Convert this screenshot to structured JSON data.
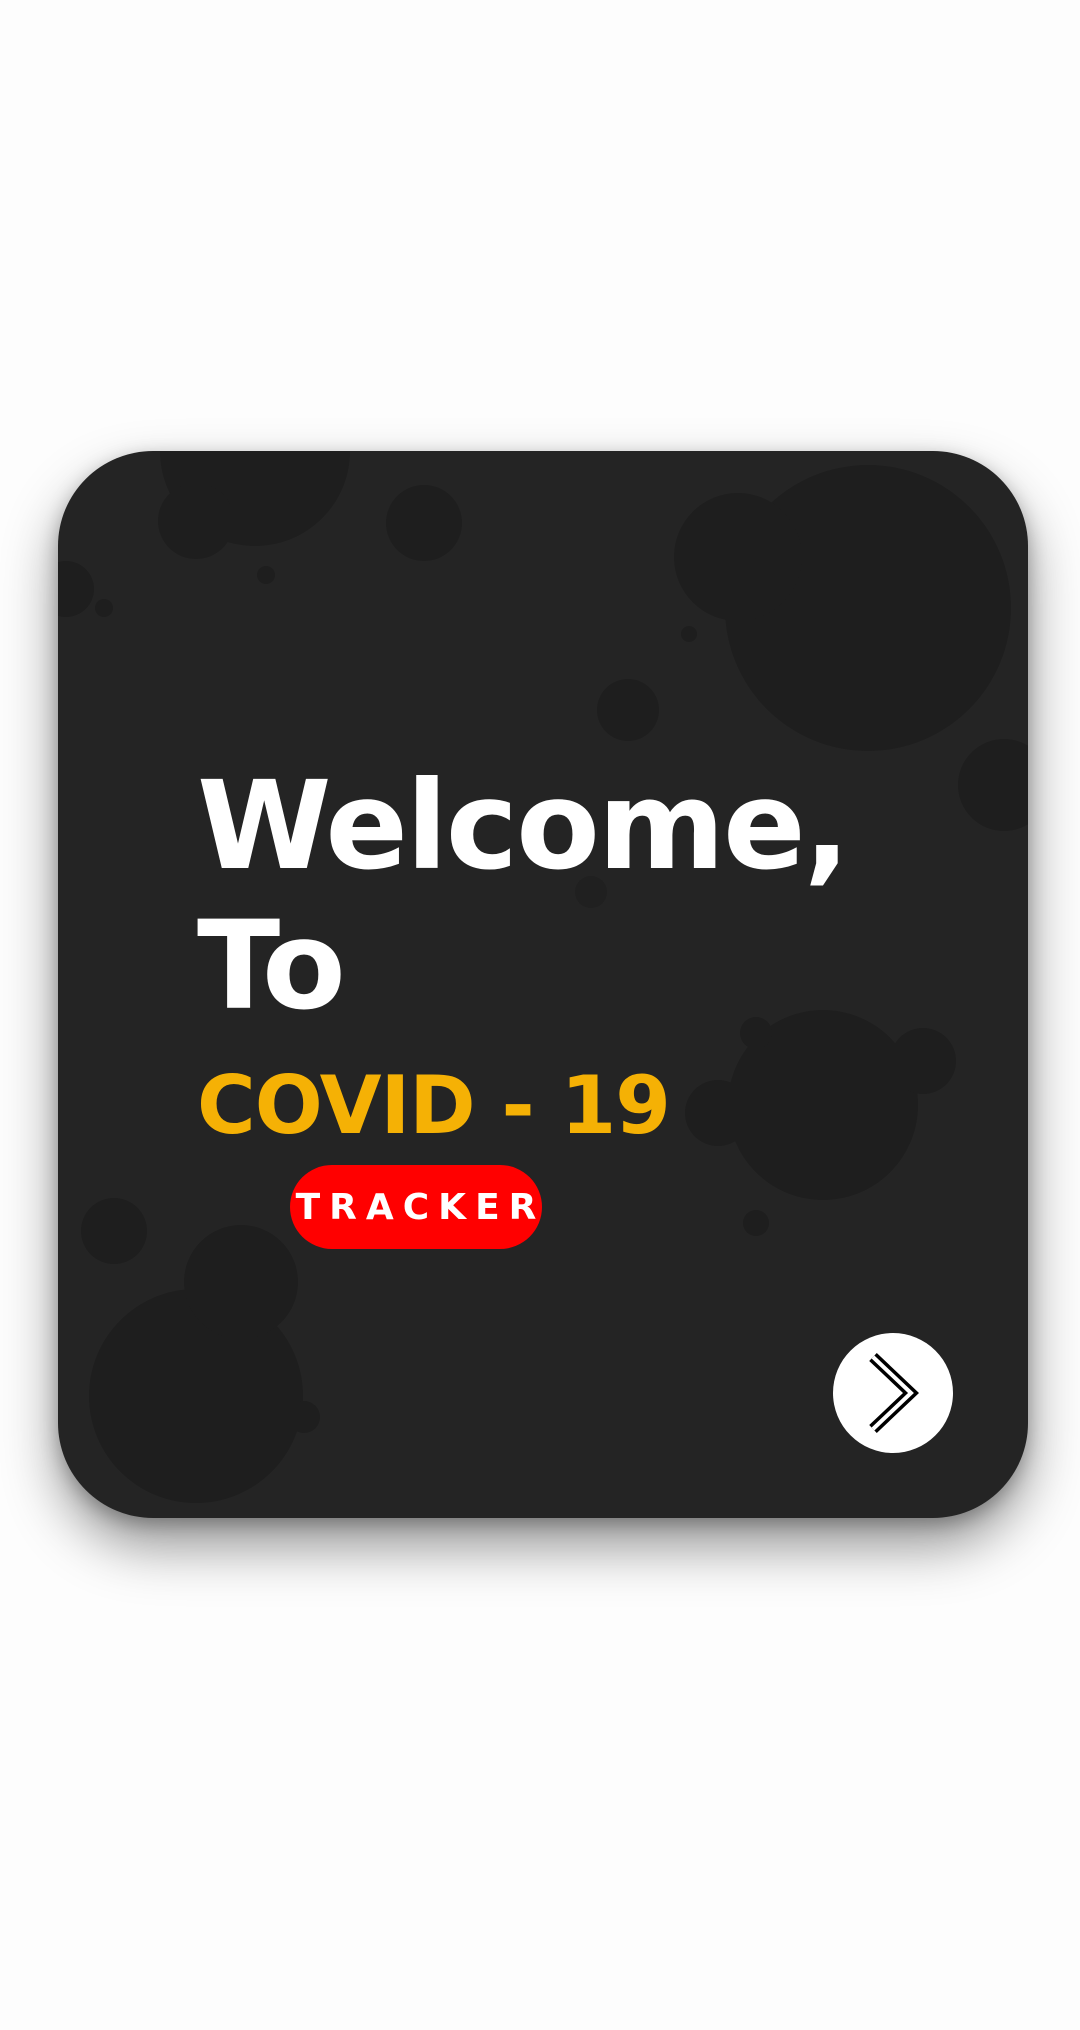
{
  "welcome": {
    "line1": "Welcome,",
    "line2": "To"
  },
  "title": "COVID - 19",
  "badge": "TRACKER",
  "next_button": {
    "icon": "chevron-right-icon"
  },
  "colors": {
    "background": "#fdfdfd",
    "card": "#242424",
    "virus_blobs": "#1e1e1e",
    "text_primary": "#ffffff",
    "accent_yellow": "#f5b105",
    "badge_red": "#ff0000",
    "button": "#ffffff"
  }
}
